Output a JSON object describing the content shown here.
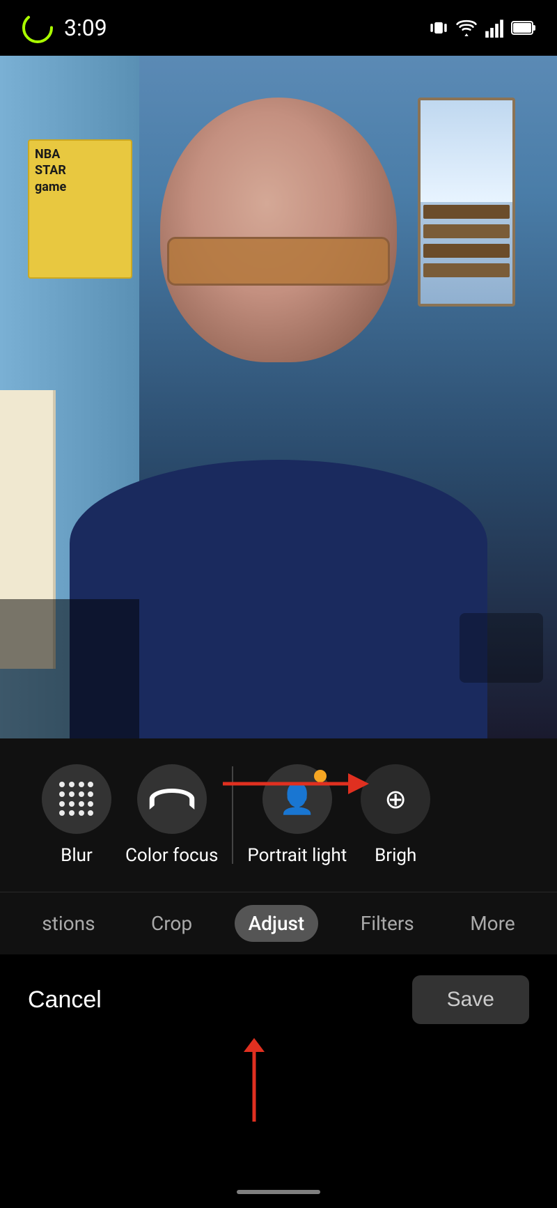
{
  "statusBar": {
    "time": "3:09",
    "icons": [
      "vibrate",
      "wifi",
      "signal",
      "battery"
    ]
  },
  "photo": {
    "description": "Man with glasses selfie in home office"
  },
  "toolsPanel": {
    "items": [
      {
        "id": "blur",
        "label": "Blur",
        "icon": "dots"
      },
      {
        "id": "color-focus",
        "label": "Color focus",
        "icon": "rainbow"
      },
      {
        "id": "portrait-light",
        "label": "Portrait light",
        "icon": "person",
        "hasDot": true
      },
      {
        "id": "brightness",
        "label": "Brigh",
        "icon": "plus-circle",
        "partial": true
      }
    ]
  },
  "tabs": [
    {
      "id": "suggestions",
      "label": "stions",
      "partial": true
    },
    {
      "id": "crop",
      "label": "Crop"
    },
    {
      "id": "adjust",
      "label": "Adjust",
      "active": true
    },
    {
      "id": "filters",
      "label": "Filters"
    },
    {
      "id": "more",
      "label": "More",
      "partial": true
    }
  ],
  "actions": {
    "cancel": "Cancel",
    "save": "Save"
  },
  "arrows": {
    "horizontal": "→",
    "vertical": "↑"
  }
}
